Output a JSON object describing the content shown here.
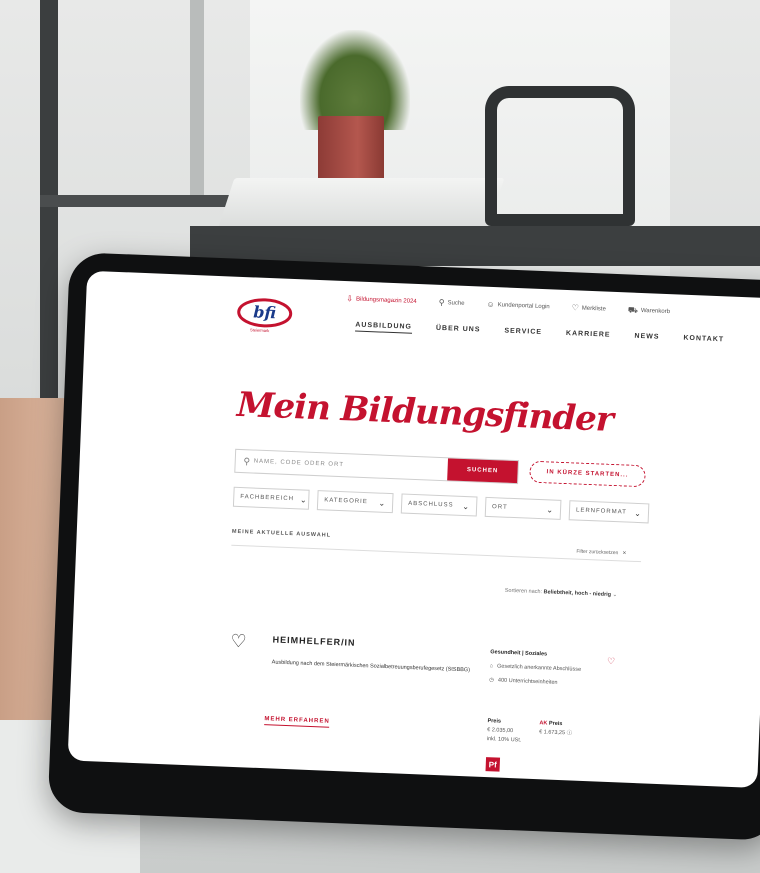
{
  "brand": {
    "logo_text": "bfi",
    "logo_sub": "Steiermark",
    "accent": "#c4122f"
  },
  "topbar": {
    "magazine": "Bildungsmagazin 2024",
    "search": "Suche",
    "login": "Kundenportal Login",
    "watchlist": "Merkliste",
    "cart": "Warenkorb"
  },
  "nav": [
    "AUSBILDUNG",
    "ÜBER UNS",
    "SERVICE",
    "KARRIERE",
    "NEWS",
    "KONTAKT"
  ],
  "headline": "Mein Bildungsfinder",
  "search": {
    "placeholder": "NAME, CODE ODER ORT",
    "button": "SUCHEN",
    "quickstart": "IN KÜRZE STARTEN..."
  },
  "filters": [
    "FACHBEREICH",
    "KATEGORIE",
    "ABSCHLUSS",
    "ORT",
    "LERNFORMAT"
  ],
  "selection_label": "MEINE AKTUELLE AUSWAHL",
  "reset_label": "Filter zurücksetzen",
  "sort": {
    "label": "Sortieren nach:",
    "value": "Beliebtheit, hoch - niedrig"
  },
  "card": {
    "title": "HEIMHELFER/IN",
    "description": "Ausbildung nach dem Steiermärkischen Sozialbetreuungsberufegesetz (StSBBG)",
    "more": "MEHR ERFAHREN",
    "category": "Gesundheit | Soziales",
    "certificate": "Gesetzlich anerkannte Abschlüsse",
    "hours": "400 Unterrichtseinheiten",
    "price_label": "Preis",
    "price": "€ 2.035,00",
    "price_note": "inkl. 10% USt.",
    "ak_badge": "AK",
    "ak_price_label": "Preis",
    "ak_price": "€ 1.673,25",
    "pr_badge": "Pf"
  }
}
